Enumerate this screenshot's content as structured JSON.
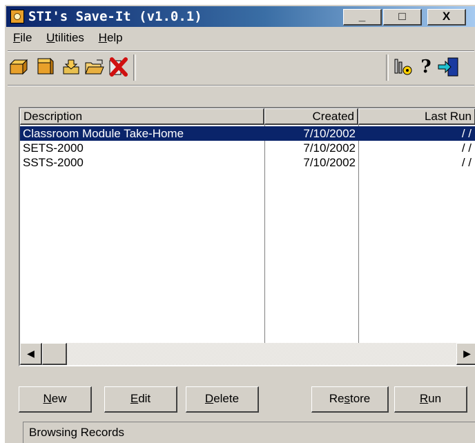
{
  "window": {
    "title": "STI's Save-It (v1.0.1)",
    "controls": {
      "minimize": "_",
      "maximize": "□",
      "close": "X"
    }
  },
  "menu": [
    {
      "label": "File",
      "accel": "F",
      "rest": "ile"
    },
    {
      "label": "Utilities",
      "accel": "U",
      "rest": "tilities"
    },
    {
      "label": "Help",
      "accel": "H",
      "rest": "elp"
    }
  ],
  "toolbar": {
    "left_icons": [
      "new-box-icon",
      "open-box-icon",
      "import-icon",
      "open-folder-icon",
      "delete-icon"
    ],
    "right_icons": [
      "tools-icon",
      "help-icon",
      "exit-door-icon"
    ]
  },
  "list": {
    "columns": [
      "Description",
      "Created",
      "Last Run"
    ],
    "rows": [
      {
        "description": "Classroom Module Take-Home",
        "created": "7/10/2002",
        "last_run": "/ /",
        "selected": true
      },
      {
        "description": "SETS-2000",
        "created": "7/10/2002",
        "last_run": "/ /",
        "selected": false
      },
      {
        "description": "SSTS-2000",
        "created": "7/10/2002",
        "last_run": "/ /",
        "selected": false
      }
    ],
    "scroll": {
      "left_arrow": "◀",
      "right_arrow": "▶"
    }
  },
  "buttons": {
    "new": {
      "accel": "N",
      "rest": "ew"
    },
    "edit": {
      "accel": "E",
      "rest": "dit"
    },
    "delete": {
      "accel": "D",
      "rest": "elete"
    },
    "restore": {
      "pre": "Re",
      "accel": "s",
      "rest": "tore"
    },
    "run": {
      "accel": "R",
      "rest": "un"
    }
  },
  "status": {
    "text": "Browsing Records"
  },
  "colors": {
    "title_start": "#0a246a",
    "title_end": "#a6caf0",
    "selection": "#0a246a",
    "face": "#d4d0c8"
  }
}
